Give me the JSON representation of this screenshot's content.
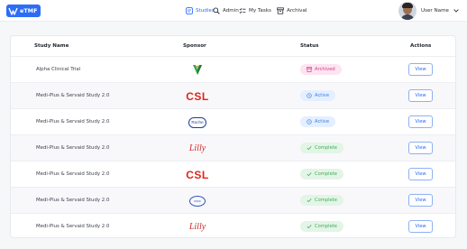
{
  "app": {
    "logo_text": "eTMF"
  },
  "nav": [
    {
      "label": "Studies",
      "icon": "studies-icon",
      "active": true
    },
    {
      "label": "Admin",
      "icon": "admin-icon",
      "active": false
    },
    {
      "label": "My Tasks",
      "icon": "tasks-icon",
      "active": false
    },
    {
      "label": "Archival",
      "icon": "archival-icon",
      "active": false
    }
  ],
  "user": {
    "name": "User Name"
  },
  "table": {
    "headers": {
      "name": "Study Name",
      "sponsor": "Sponsor",
      "status": "Status",
      "actions": "Actions"
    },
    "rows": [
      {
        "study": "Alpha Clinical Trial",
        "sponsor": "green-v-logo",
        "status": "Archived",
        "action": "View"
      },
      {
        "study": "Medi-Plus & Servaid Study 2.0",
        "sponsor": "CSL",
        "status": "Active",
        "action": "View"
      },
      {
        "study": "Medi-Plus & Servaid Study 2.0",
        "sponsor": "Roche",
        "status": "Active",
        "action": "View"
      },
      {
        "study": "Medi-Plus & Servaid Study 2.0",
        "sponsor": "Lilly",
        "status": "Complete",
        "action": "View"
      },
      {
        "study": "Medi-Plus & Servaid Study 2.0",
        "sponsor": "CSL",
        "status": "Complete",
        "action": "View"
      },
      {
        "study": "Medi-Plus & Servaid Study 2.0",
        "sponsor": "novo",
        "status": "Complete",
        "action": "View"
      },
      {
        "study": "Medi-Plus & Servaid Study 2.0",
        "sponsor": "Lilly",
        "status": "Complete",
        "action": "View"
      }
    ]
  },
  "colors": {
    "accent": "#2d6cf6",
    "archived": "#d63f8c",
    "active": "#3f7bf0",
    "complete": "#44ad5a"
  }
}
